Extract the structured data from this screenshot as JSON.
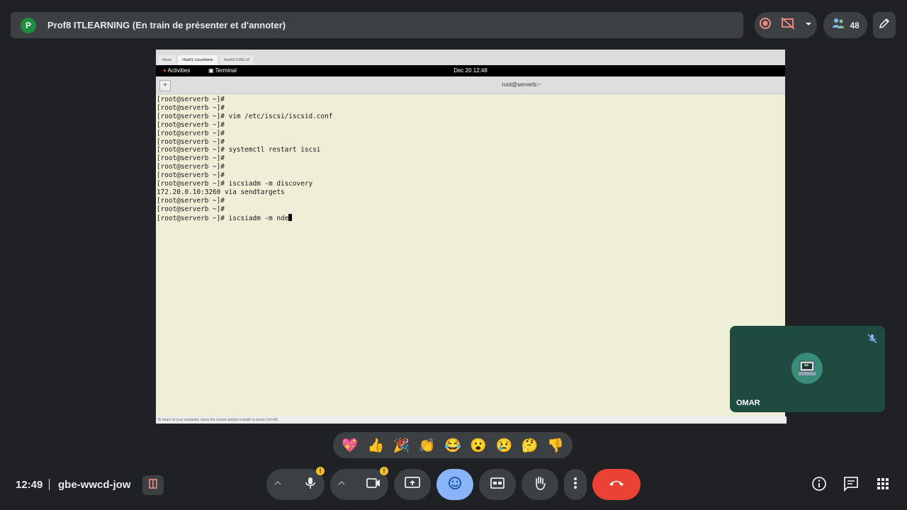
{
  "topbar": {
    "avatar_letter": "P",
    "title": "Prof8 ITLEARNING (En train de présenter et d'annoter)",
    "participants_count": "48"
  },
  "screen": {
    "tabs": [
      "Home",
      "Host01 LinuxAdmin",
      "Host03 GHEL10"
    ],
    "gnome": {
      "activities": "Activities",
      "app": "Terminal",
      "clock": "Dec 20  12:48"
    },
    "terminal_title": "root@serverb:~",
    "terminal_text": "[root@serverb ~]#\n[root@serverb ~]#\n[root@serverb ~]# vim /etc/iscsi/iscsid.conf\n[root@serverb ~]#\n[root@serverb ~]#\n[root@serverb ~]#\n[root@serverb ~]# systemctl restart iscsi\n[root@serverb ~]#\n[root@serverb ~]#\n[root@serverb ~]#\n[root@serverb ~]# iscsiadm -m discovery\n172.20.0.10:3260 via sendtargets\n[root@serverb ~]#\n[root@serverb ~]#\n[root@serverb ~]# iscsiadm -m nde",
    "vm_hint": "To return to your computer, move the mouse pointer outside or press Ctrl+Alt."
  },
  "tile": {
    "name": "OMAR"
  },
  "reactions": [
    "💖",
    "👍",
    "🎉",
    "👏",
    "😂",
    "😮",
    "😢",
    "🤔",
    "👎"
  ],
  "bottom": {
    "time": "12:49",
    "meeting_code": "gbe-wwcd-jow",
    "warn_symbol": "!"
  },
  "colors": {
    "background": "#202124",
    "panel": "#3c4043",
    "active": "#8ab4f8",
    "hangup": "#ea4335",
    "warning": "#f6c026"
  },
  "icons": [
    "record-icon",
    "present-icon",
    "chevron-down-icon",
    "people-icon",
    "annotate-icon",
    "mic-icon",
    "camera-icon",
    "present-screen-icon",
    "emoji-icon",
    "captions-icon",
    "raise-hand-icon",
    "more-icon",
    "hangup-icon",
    "info-icon",
    "chat-icon",
    "apps-icon",
    "mic-off-icon",
    "host-controls-icon"
  ]
}
